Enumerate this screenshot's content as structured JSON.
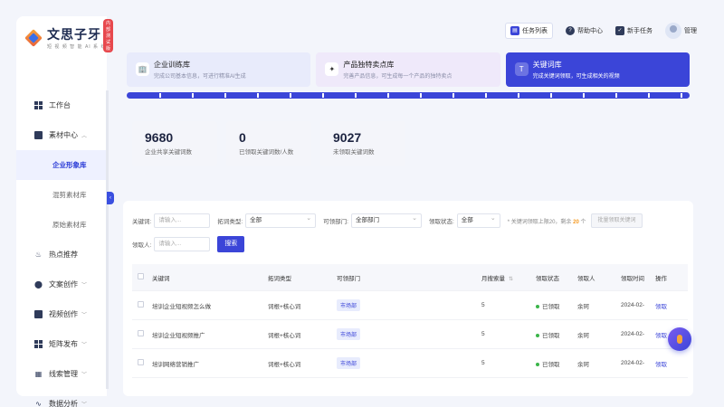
{
  "app": {
    "logo_title": "文思子牙",
    "logo_subtitle": "短 视 频 智 能 AI 系 统",
    "test_badge": "内部测试版"
  },
  "sidebar": {
    "items": [
      {
        "label": "工作台",
        "icon": "grid-icon"
      },
      {
        "label": "素材中心",
        "icon": "folder-icon",
        "expanded": true
      },
      {
        "label": "热点推荐",
        "icon": "fire-icon"
      },
      {
        "label": "文案创作",
        "icon": "location-pin-icon"
      },
      {
        "label": "视频创作",
        "icon": "video-icon"
      },
      {
        "label": "矩阵发布",
        "icon": "grid-icon"
      },
      {
        "label": "线索管理",
        "icon": "clue-icon"
      },
      {
        "label": "数据分析",
        "icon": "chart-icon"
      }
    ],
    "sub_items": [
      {
        "label": "企业形象库",
        "active": true
      },
      {
        "label": "混剪素材库",
        "active": false
      },
      {
        "label": "原始素材库",
        "active": false
      }
    ]
  },
  "topbar": {
    "task_list": "任务列表",
    "help_center": "帮助中心",
    "newbie_task": "新手任务",
    "user_name": "管理"
  },
  "cards": [
    {
      "title": "企业训练库",
      "desc": "完成公司基本信息，可进行精准AI生成"
    },
    {
      "title": "产品独特卖点库",
      "desc": "完善产品信息，可生成每一个产品的独特卖点"
    },
    {
      "title": "关键词库",
      "desc": "完成关键词领取，可生成相关的视频"
    }
  ],
  "stats": [
    {
      "value": "9680",
      "label": "企业共享关键词数"
    },
    {
      "value": "0",
      "label": "已领取关键词数/人数"
    },
    {
      "value": "9027",
      "label": "未领取关键词数"
    }
  ],
  "filters": {
    "keyword_label": "关键词:",
    "keyword_placeholder": "请输入...",
    "expand_type_label": "拓词类型:",
    "expand_type_value": "全部",
    "dept_label": "可领部门:",
    "dept_value": "全部部门",
    "status_label": "领取状态:",
    "status_value": "全部",
    "hint_prefix": "* 关键词领取上限20，剩余",
    "hint_count": "20",
    "hint_suffix": "个",
    "batch_button": "批量领取关键词",
    "receiver_label": "领取人:",
    "receiver_placeholder": "请输入...",
    "search_button": "搜索"
  },
  "table": {
    "headers": [
      "关键词",
      "拓词类型",
      "可领部门",
      "月搜索量",
      "领取状态",
      "领取人",
      "领取时间",
      "操作"
    ],
    "rows": [
      {
        "keyword": "培训企业短视频怎么做",
        "type": "词根+核心词",
        "dept": "市场部",
        "volume": "5",
        "status": "已领取",
        "receiver": "余珂",
        "time": "2024-02-",
        "action": "领取"
      },
      {
        "keyword": "培训企业短视频推广",
        "type": "词根+核心词",
        "dept": "市场部",
        "volume": "5",
        "status": "已领取",
        "receiver": "余珂",
        "time": "2024-02-",
        "action": "领取"
      },
      {
        "keyword": "培训网络营销推广",
        "type": "词根+核心词",
        "dept": "市场部",
        "volume": "5",
        "status": "已领取",
        "receiver": "余珂",
        "time": "2024-02-",
        "action": "领取"
      }
    ]
  },
  "colors": {
    "accent": "#3b45d8",
    "status_ok": "#3bb54a",
    "warn": "#f59a23"
  }
}
